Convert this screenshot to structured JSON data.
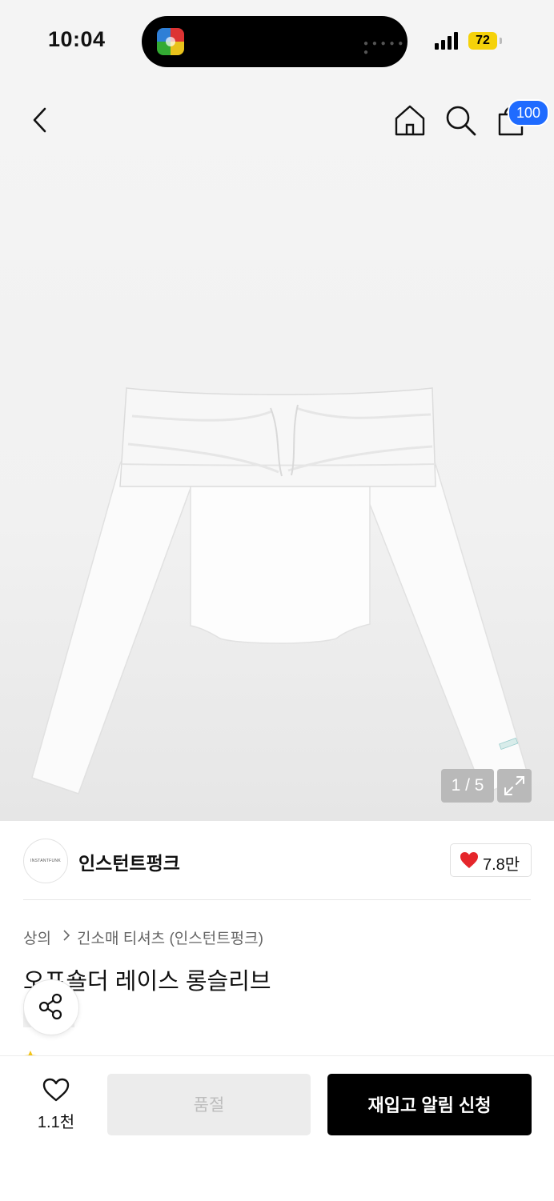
{
  "status_bar": {
    "time": "10:04",
    "battery": "72",
    "battery_color": "#f5d20a"
  },
  "nav": {
    "back_icon": "chevron-left-icon",
    "home_icon": "home-icon",
    "search_icon": "search-icon",
    "cart_icon": "shopping-bag-icon",
    "cart_badge": "100",
    "badge_color": "#1f6bff"
  },
  "gallery": {
    "counter": "1 / 5",
    "current": 1,
    "total": 5,
    "expand_icon": "expand-icon"
  },
  "brand": {
    "logo_text": "INSTANTFUNK",
    "name": "인스턴트펑크",
    "like_count": "7.8만",
    "heart_color": "#e5262b"
  },
  "breadcrumb": {
    "category": "상의",
    "subcategory": "긴소매 티셔츠 (인스턴트펑크)"
  },
  "product": {
    "title": "오프숄더 레이스 롱슬리브"
  },
  "bottom_bar": {
    "wish_count": "1.1천",
    "soldout_label": "품절",
    "restock_label": "재입고 알림 신청"
  }
}
